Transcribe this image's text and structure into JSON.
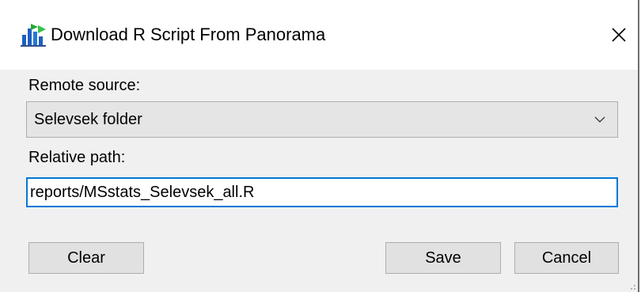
{
  "window": {
    "title": "Download R Script From Panorama",
    "icons": {
      "app": "panorama-app-icon",
      "close": "close-icon"
    }
  },
  "form": {
    "remote_source_label": "Remote source:",
    "remote_source_value": "Selevsek folder",
    "relative_path_label": "Relative path:",
    "relative_path_value": "reports/MSstats_Selevsek_all.R"
  },
  "buttons": {
    "clear": "Clear",
    "save": "Save",
    "cancel": "Cancel"
  },
  "colors": {
    "focus_border": "#0078d7",
    "dialog_bg": "#f0f0f0",
    "button_bg": "#e1e1e1"
  }
}
